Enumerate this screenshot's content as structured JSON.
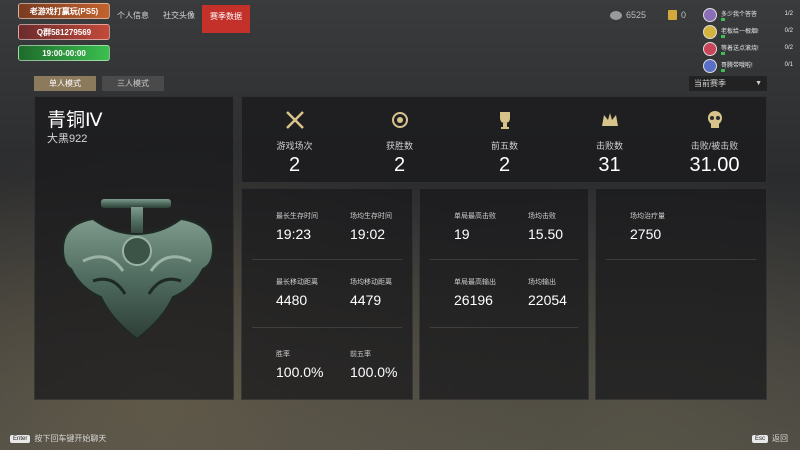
{
  "promos": [
    "老游戏打赢玩(PS5)",
    "Q群581279569",
    "19:00-00:00"
  ],
  "nav": {
    "tabs": [
      "个人信息",
      "社交头像",
      "赛季数据"
    ],
    "active_index": 2
  },
  "currency": {
    "coins": "6525",
    "gold": "0"
  },
  "team": [
    {
      "name": "多少我个答答",
      "count": "1/2"
    },
    {
      "name": "老板给一根烟!",
      "count": "0/2"
    },
    {
      "name": "等着送点滚烧!",
      "count": "0/2"
    },
    {
      "name": "哥腾带哦啦!",
      "count": "0/1"
    }
  ],
  "modes": {
    "solo": "单人模式",
    "trio": "三人模式",
    "active": "solo"
  },
  "season_select": {
    "value": "当前赛季"
  },
  "rank": {
    "tier": "青铜Ⅳ",
    "player": "大黑922"
  },
  "top_stats": [
    {
      "icon": "crossed-swords-icon",
      "label": "游戏场次",
      "value": "2"
    },
    {
      "icon": "laurel-emblem-icon",
      "label": "获胜数",
      "value": "2"
    },
    {
      "icon": "trophy-icon",
      "label": "前五数",
      "value": "2"
    },
    {
      "icon": "crown-icon",
      "label": "击败数",
      "value": "31"
    },
    {
      "icon": "skull-icon",
      "label": "击败/被击败",
      "value": "31.00"
    }
  ],
  "panel_left": [
    {
      "label": "最长生存时间",
      "value": "19:23"
    },
    {
      "label": "场均生存时间",
      "value": "19:02"
    },
    {
      "label": "最长移动距离",
      "value": "4480"
    },
    {
      "label": "场均移动距离",
      "value": "4479"
    },
    {
      "label": "胜率",
      "value": "100.0%"
    },
    {
      "label": "前五率",
      "value": "100.0%"
    }
  ],
  "panel_mid": [
    {
      "label": "单局最高击败",
      "value": "19"
    },
    {
      "label": "场均击败",
      "value": "15.50"
    },
    {
      "label": "单局最高输出",
      "value": "26196"
    },
    {
      "label": "场均输出",
      "value": "22054"
    }
  ],
  "panel_right": [
    {
      "label": "场均治疗量",
      "value": "2750"
    }
  ],
  "bottom": {
    "enter_key": "Enter",
    "enter_hint": "按下回车键开始聊天",
    "esc_key": "Esc",
    "esc_hint": "返回"
  },
  "colors": {
    "accent_red": "#c4302a",
    "mode_active": "#8c7a5c",
    "gold": "#d3a93e"
  }
}
